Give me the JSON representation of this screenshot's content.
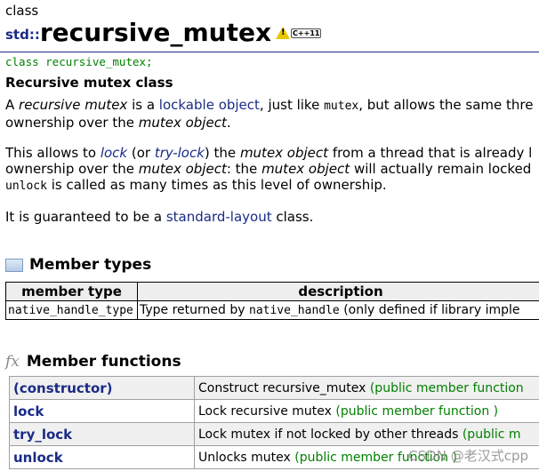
{
  "kicker": "class",
  "header": {
    "namespace": "std::",
    "title": "recursive_mutex",
    "badge_tag": "C++11"
  },
  "declaration": "class recursive_mutex;",
  "heading": "Recursive mutex class",
  "p1": {
    "a": "A ",
    "em1": "recursive mutex",
    "b": " is a ",
    "link1": "lockable object",
    "c": ", just like ",
    "code1": "mutex",
    "d": ", but allows the same thre",
    "line2a": "ownership over the ",
    "em2": "mutex object",
    "line2b": "."
  },
  "p2": {
    "a": "This allows to ",
    "link1": "lock",
    "b": " (or ",
    "link2": "try-lock",
    "c": ") the ",
    "em1": "mutex object",
    "d": " from a thread that is already l",
    "l2a": "ownership over the ",
    "em2": "mutex object",
    "l2b": ": the ",
    "em3": "mutex object",
    "l2c": " will actually remain locked",
    "code1": "unlock",
    "l3": " is called as many times as this level of ownership."
  },
  "p3": {
    "a": "It is guaranteed to be a ",
    "link1": "standard-layout",
    "b": " class."
  },
  "member_types": {
    "title": "Member types",
    "headers": [
      "member type",
      "description"
    ],
    "rows": [
      {
        "type": "native_handle_type",
        "desc_a": "Type returned by ",
        "desc_code": "native_handle",
        "desc_b": " (only defined if library imple"
      }
    ]
  },
  "member_functions": {
    "fx": "fx",
    "title": "Member functions",
    "rows": [
      {
        "name": "(constructor)",
        "desc": "Construct recursive_mutex ",
        "kind": "(public member function"
      },
      {
        "name": "lock",
        "desc": "Lock recursive mutex ",
        "kind": "(public member function )"
      },
      {
        "name": "try_lock",
        "desc": "Lock mutex if not locked by other threads ",
        "kind": "(public m"
      },
      {
        "name": "unlock",
        "desc": "Unlocks mutex ",
        "kind": "(public member function )"
      }
    ]
  },
  "watermark": "CSDN @老汉式cpp"
}
